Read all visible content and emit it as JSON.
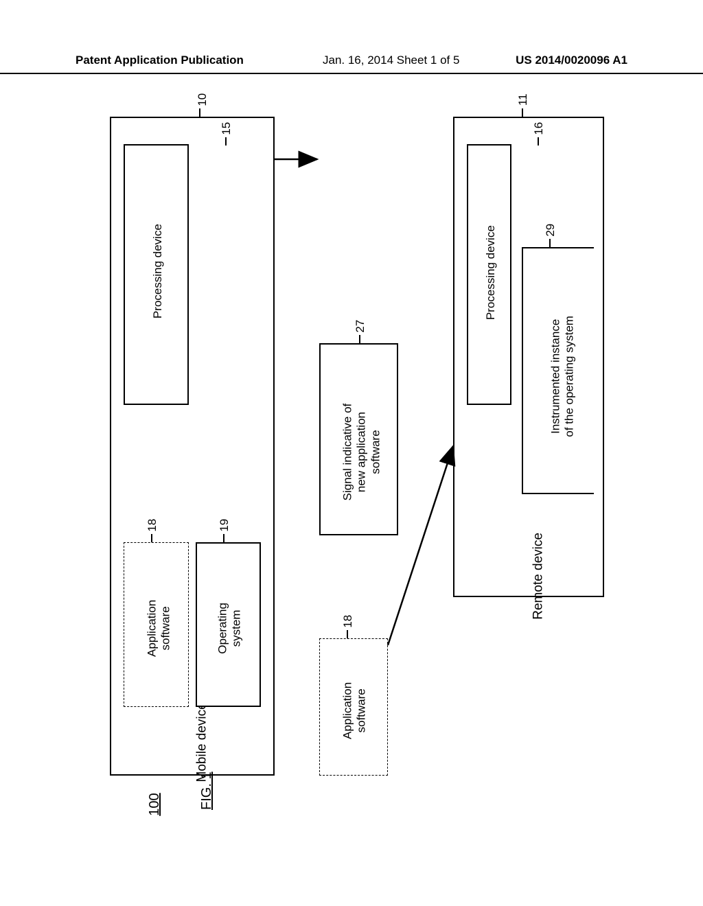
{
  "header": {
    "left": "Patent Application Publication",
    "middle": "Jan. 16, 2014  Sheet 1 of 5",
    "right": "US 2014/0020096 A1"
  },
  "boxes": {
    "mobile": {
      "ref": "10",
      "label": "Mobile device",
      "processing": {
        "ref": "15",
        "text": "Processing device"
      },
      "app": {
        "ref": "18",
        "text": "Application software"
      },
      "os": {
        "ref": "19",
        "text": "Operating system"
      }
    },
    "signal": {
      "ref": "27",
      "text": "Signal indicative of new application software"
    },
    "remote": {
      "ref": "11",
      "label": "Remote device",
      "processing": {
        "ref": "16",
        "text": "Processing device"
      },
      "instr": {
        "ref": "29",
        "text": "Instrumented instance of the operating system"
      }
    },
    "appcopy": {
      "ref": "18",
      "text": "Application software"
    }
  },
  "system_ref": "100",
  "figure": "FIG. 1"
}
